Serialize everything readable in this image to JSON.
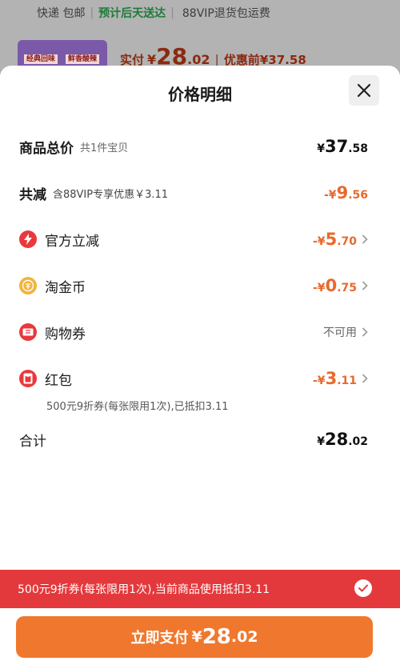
{
  "background": {
    "shipping": {
      "delivery": "快递 包邮",
      "eta": "预计后天送达",
      "vip": "88VIP退货包运费"
    },
    "product_tags": [
      "经典回味",
      "鲜香酸辣"
    ],
    "price": {
      "label": "实付",
      "symbol": "¥",
      "int": "28",
      "dec": ".02",
      "before_label": "优惠前",
      "before_value": "¥37.58"
    }
  },
  "sheet": {
    "title": "价格明细",
    "total": {
      "label": "商品总价",
      "sub": "共1件宝贝",
      "amount": {
        "symbol": "¥",
        "int": "37",
        "dec": ".58"
      }
    },
    "reduce": {
      "label": "共减",
      "sub": "含88VIP专享优惠￥3.11",
      "amount": {
        "symbol": "-¥",
        "int": "9",
        "dec": ".56"
      }
    },
    "items": [
      {
        "icon": "lightning-icon",
        "label": "官方立减",
        "amount": {
          "symbol": "-¥",
          "int": "5",
          "dec": ".70"
        }
      },
      {
        "icon": "taojinbi-coin-icon",
        "label": "淘金币",
        "amount": {
          "symbol": "-¥",
          "int": "0",
          "dec": ".75"
        }
      },
      {
        "icon": "coupon-icon",
        "label": "购物券",
        "status": "不可用"
      },
      {
        "icon": "red-envelope-icon",
        "label": "红包",
        "amount": {
          "symbol": "-¥",
          "int": "3",
          "dec": ".11"
        }
      }
    ],
    "red_packet_note": "500元9折券(每张限用1次),已抵扣3.11",
    "sum": {
      "label": "合计",
      "amount": {
        "symbol": "¥",
        "int": "28",
        "dec": ".02"
      }
    }
  },
  "banner": {
    "text": "500元9折券(每张限用1次),当前商品使用抵扣3.11"
  },
  "pay_button": {
    "label": "立即支付",
    "symbol": "¥",
    "int": "28",
    "dec": ".02"
  },
  "colors": {
    "accent_orange": "#f0782e",
    "discount_orange": "#e8692c",
    "banner_red": "#e4393c"
  }
}
